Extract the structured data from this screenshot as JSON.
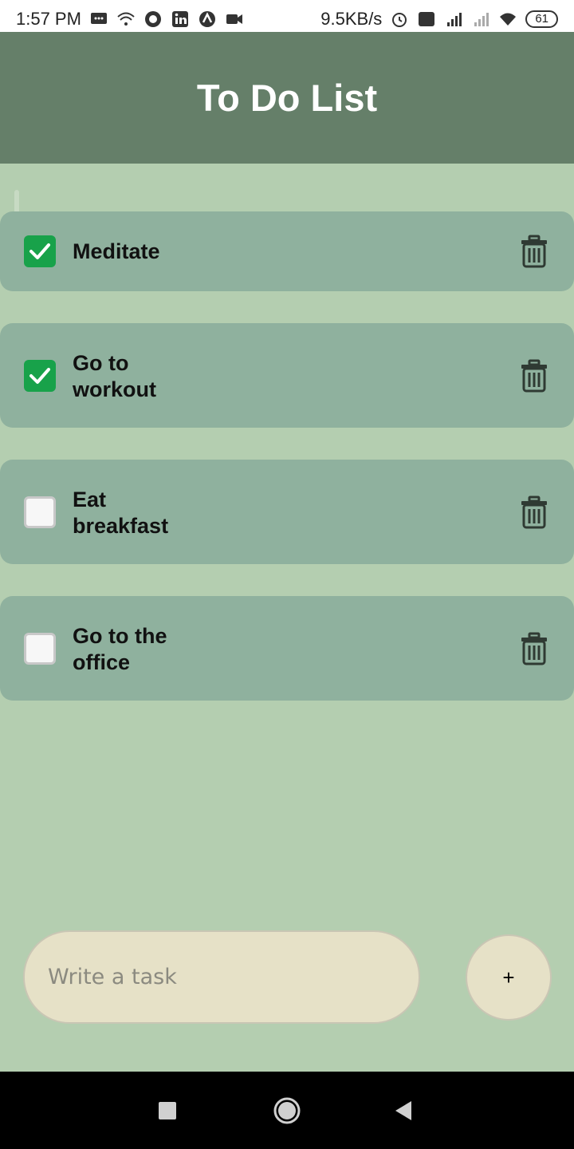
{
  "status_bar": {
    "time": "1:57 PM",
    "speed": "9.5KB/s",
    "battery": "61",
    "icons_left": [
      "message-icon",
      "wifi-icon",
      "circle-app-icon",
      "linkedin-icon",
      "arc-app-icon",
      "video-icon"
    ],
    "icons_right": [
      "alarm-icon",
      "volte-icon",
      "4g-signal-icon",
      "signal-icon",
      "wifi-icon"
    ]
  },
  "header": {
    "title": "To Do List"
  },
  "tasks": [
    {
      "label": "Meditate",
      "checked": true
    },
    {
      "label": "Go to workout",
      "checked": true
    },
    {
      "label": "Eat breakfast",
      "checked": false
    },
    {
      "label": "Go to the office",
      "checked": false
    }
  ],
  "composer": {
    "placeholder": "Write a task",
    "add_label": "+"
  },
  "colors": {
    "header": "#657f69",
    "background": "#b4ceb0",
    "task_card": "#8fb19e",
    "checkbox_checked": "#18a24a",
    "input": "#e6e1c7"
  },
  "nav": {
    "buttons": [
      "recents-square-icon",
      "home-circle-icon",
      "back-triangle-icon"
    ]
  }
}
